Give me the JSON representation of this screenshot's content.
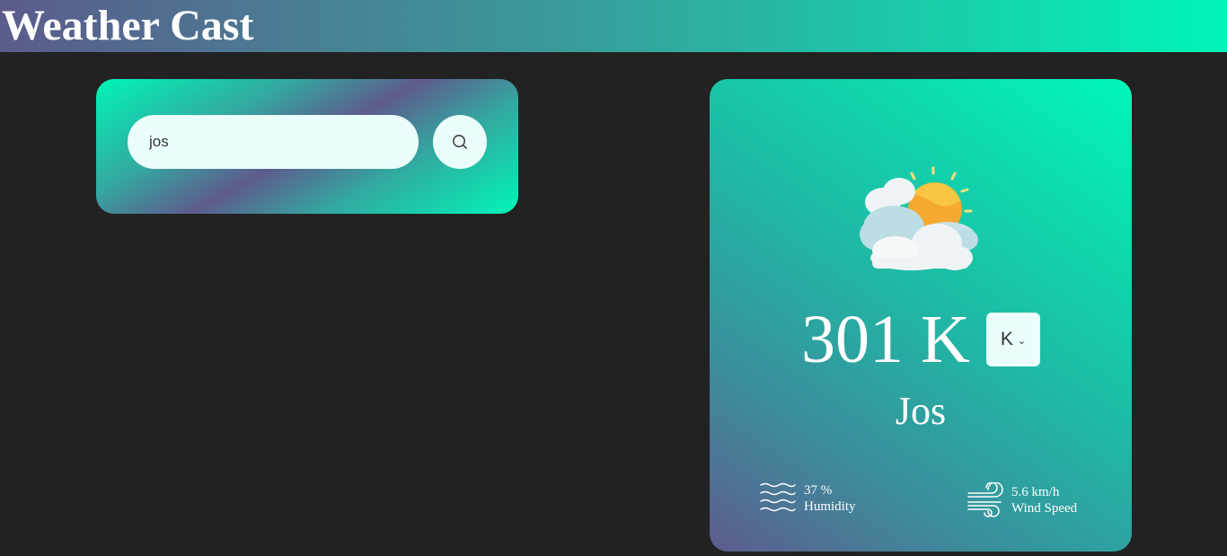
{
  "header": {
    "title": "Weather Cast",
    "gradient": [
      "#5b5b8c",
      "#3a9a9a",
      "#00f5b8"
    ]
  },
  "search": {
    "value": "jos",
    "button_icon": "search-icon"
  },
  "weather": {
    "icon": "partly-cloudy-icon",
    "temperature": "301 K",
    "unit": "K",
    "city": "Jos",
    "humidity": {
      "icon": "humidity-waves-icon",
      "value": "37 %",
      "label": "Humidity"
    },
    "wind": {
      "icon": "wind-icon",
      "value": "5.6 km/h",
      "label": "Wind Speed"
    }
  },
  "colors": {
    "background": "#222222",
    "accent": "#00f5b8",
    "purple": "#5e5b8e",
    "input_bg": "#eafffb"
  }
}
